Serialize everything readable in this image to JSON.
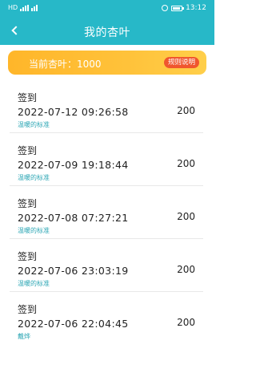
{
  "status": {
    "time": "13:12",
    "carrier": "HD"
  },
  "nav": {
    "title": "我的杏叶"
  },
  "balance": {
    "label": "当前杏叶：1000",
    "rules": "规则说明"
  },
  "records": [
    {
      "title": "签到",
      "time": "2022-07-12 09:26:58",
      "amount": "200",
      "note": "温暖的标准"
    },
    {
      "title": "签到",
      "time": "2022-07-09 19:18:44",
      "amount": "200",
      "note": "温暖的标准"
    },
    {
      "title": "签到",
      "time": "2022-07-08 07:27:21",
      "amount": "200",
      "note": "温暖的标准"
    },
    {
      "title": "签到",
      "time": "2022-07-06 23:03:19",
      "amount": "200",
      "note": "温暖的标准"
    },
    {
      "title": "签到",
      "time": "2022-07-06 22:04:45",
      "amount": "200",
      "note": "戴烨"
    }
  ]
}
